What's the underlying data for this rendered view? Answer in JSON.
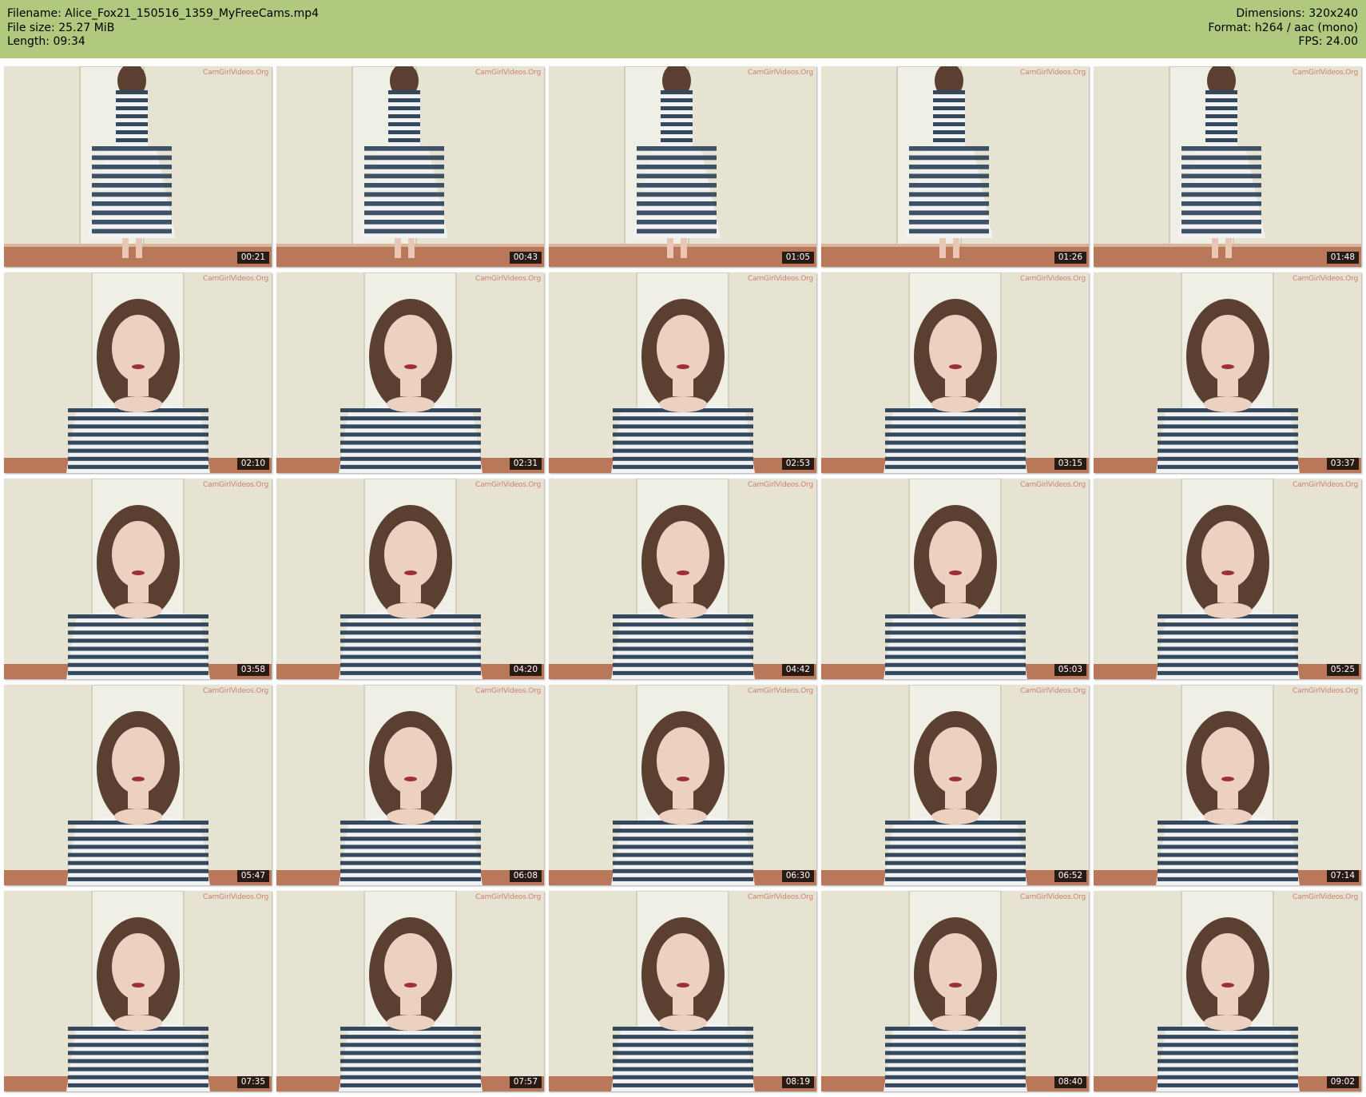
{
  "header": {
    "filename": "Filename: Alice_Fox21_150516_1359_MyFreeCams.mp4",
    "file_size": "File size: 25.27 MiB",
    "length": "Length: 09:34",
    "dimensions": "Dimensions: 320x240",
    "format": "Format: h264 / aac (mono)",
    "fps": "FPS: 24.00"
  },
  "colors": {
    "header_bg": "#b0c97e",
    "wall": "#e6e3d2",
    "floor": "#b9785a",
    "door": "#f0efe6",
    "dress_stripe_dark": "#34495e",
    "hair": "#5b3f30"
  },
  "watermark_text": "CamGirlVideos.Org",
  "thumbnails": [
    {
      "time": "00:21",
      "scene": "full-body"
    },
    {
      "time": "00:43",
      "scene": "full-body"
    },
    {
      "time": "01:05",
      "scene": "full-body"
    },
    {
      "time": "01:26",
      "scene": "full-body"
    },
    {
      "time": "01:48",
      "scene": "full-body"
    },
    {
      "time": "02:10",
      "scene": "portrait"
    },
    {
      "time": "02:31",
      "scene": "portrait"
    },
    {
      "time": "02:53",
      "scene": "portrait"
    },
    {
      "time": "03:15",
      "scene": "portrait"
    },
    {
      "time": "03:37",
      "scene": "portrait"
    },
    {
      "time": "03:58",
      "scene": "portrait"
    },
    {
      "time": "04:20",
      "scene": "portrait"
    },
    {
      "time": "04:42",
      "scene": "portrait"
    },
    {
      "time": "05:03",
      "scene": "portrait"
    },
    {
      "time": "05:25",
      "scene": "portrait"
    },
    {
      "time": "05:47",
      "scene": "portrait"
    },
    {
      "time": "06:08",
      "scene": "portrait"
    },
    {
      "time": "06:30",
      "scene": "portrait"
    },
    {
      "time": "06:52",
      "scene": "portrait"
    },
    {
      "time": "07:14",
      "scene": "portrait"
    },
    {
      "time": "07:35",
      "scene": "portrait"
    },
    {
      "time": "07:57",
      "scene": "portrait"
    },
    {
      "time": "08:19",
      "scene": "portrait"
    },
    {
      "time": "08:40",
      "scene": "portrait"
    },
    {
      "time": "09:02",
      "scene": "portrait"
    }
  ]
}
